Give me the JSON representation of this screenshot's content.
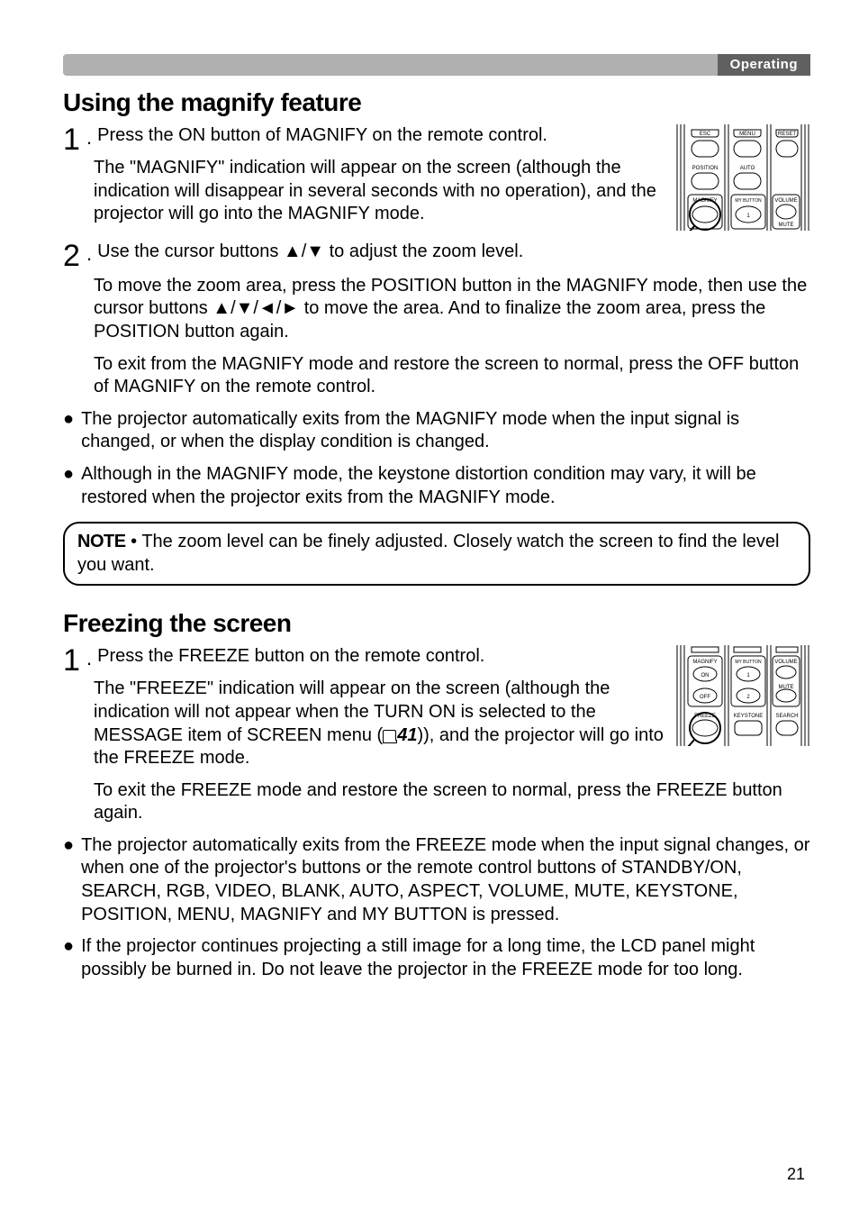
{
  "header": {
    "section_label": "Operating"
  },
  "magnify": {
    "heading": "Using the magnify feature",
    "step1_line1": "Press the ON button of MAGNIFY on the remote control.",
    "step1_cont": "The \"MAGNIFY\" indication will appear on the screen (although the indication will disappear in several seconds with no operation), and the projector will go into the MAGNIFY mode.",
    "step2_line1": "Use the cursor buttons ▲/▼ to adjust the zoom level.",
    "step2_p1": "To move the zoom area, press the POSITION button in the MAGNIFY mode, then use the cursor buttons ▲/▼/◄/► to move the area. And to finalize the zoom area, press the POSITION button again.",
    "step2_p2": "To exit from the MAGNIFY mode and restore the screen to normal, press the OFF button of MAGNIFY on the remote control.",
    "bullet1": "The projector automatically exits from the MAGNIFY mode when the input signal is changed, or when the display condition is changed.",
    "bullet2": "Although in the MAGNIFY mode, the keystone distortion condition may vary, it will be restored when the projector exits from the MAGNIFY mode.",
    "note_label": "NOTE",
    "note_text": " • The zoom level can be finely adjusted. Closely watch the screen to find the level you want."
  },
  "freeze": {
    "heading": "Freezing the screen",
    "step1_line1": "Press the FREEZE button on the remote control.",
    "step1_cont_a": "The \"FREEZE\" indication will appear on the screen (although the indication will not appear when the TURN ON is selected to the MESSAGE item of SCREEN menu (",
    "ref_num": "41",
    "step1_cont_b": ")), and the projector will go into the FREEZE mode.",
    "p2": "To exit the FREEZE mode and restore the screen to normal, press the FREEZE button again.",
    "bullet1": "The projector automatically exits from the FREEZE mode when the input signal changes, or when one of the projector's buttons or the remote control buttons of STANDBY/ON, SEARCH, RGB, VIDEO, BLANK, AUTO, ASPECT, VOLUME, MUTE, KEYSTONE, POSITION, MENU, MAGNIFY and MY BUTTON is pressed.",
    "bullet2": "If the projector continues projecting a still image for a long time, the LCD panel might possibly be burned in. Do not leave the projector in the FREEZE mode for too long."
  },
  "remote1": {
    "labels": {
      "esc": "ESC",
      "menu": "MENU",
      "reset": "RESET",
      "position": "POSITION",
      "auto": "AUTO",
      "magnify": "MAGNIFY",
      "mybutton": "MY BUTTON",
      "volume": "VOLUME",
      "mute": "MUTE",
      "one": "1"
    }
  },
  "remote2": {
    "labels": {
      "magnify": "MAGNIFY",
      "mybutton": "MY BUTTON",
      "volume": "VOLUME",
      "on": "ON",
      "one": "1",
      "off": "OFF",
      "two": "2",
      "mute": "MUTE",
      "freeze": "FREEZE",
      "keystone": "KEYSTONE",
      "search": "SEARCH"
    }
  },
  "page_number": "21"
}
